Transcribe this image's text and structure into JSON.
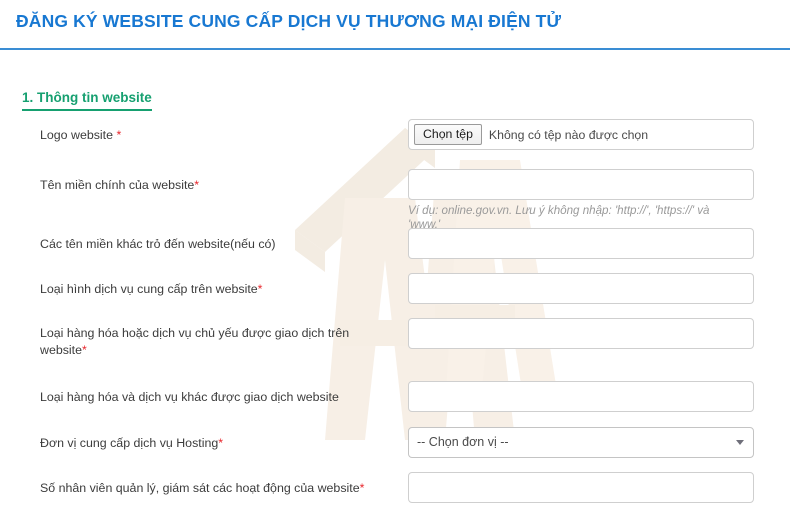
{
  "header": {
    "title": "ĐĂNG KÝ WEBSITE CUNG CẤP DỊCH VỤ THƯƠNG MẠI ĐIỆN TỬ",
    "rule_color": "#3a8dd4",
    "title_color": "#1878d2"
  },
  "section": {
    "heading": "1. Thông tin website",
    "heading_color": "#16a070"
  },
  "colors": {
    "required_marker": "#e8262c",
    "input_border": "#cfcfcf",
    "hint_text": "#9a9a9a",
    "label_text": "#3c3c3c"
  },
  "fields": {
    "logo": {
      "label": "Logo website ",
      "required_marker": "*",
      "control": "file",
      "button_label": "Chọn tệp",
      "status_text": "Không có tệp nào được chọn"
    },
    "main_domain": {
      "label": "Tên miền chính của website",
      "required_marker": "*",
      "control": "text",
      "value": "",
      "placeholder": "",
      "hint": "Ví dụ: online.gov.vn. Lưu ý không nhập: 'http://', 'https://' và 'www.'"
    },
    "other_domains": {
      "label": "Các tên miền khác trỏ đến website(nếu có)",
      "required_marker": "",
      "control": "text",
      "value": "",
      "placeholder": ""
    },
    "service_type": {
      "label": "Loại hình dịch vụ cung cấp trên website",
      "required_marker": "*",
      "control": "text",
      "value": "",
      "placeholder": ""
    },
    "main_goods": {
      "label": "Loại hàng hóa hoặc dịch vụ chủ yếu được giao dịch trên website",
      "required_marker": "*",
      "control": "text",
      "value": "",
      "placeholder": ""
    },
    "other_goods": {
      "label": "Loại hàng hóa và dịch vụ khác được giao dịch website",
      "required_marker": "",
      "control": "text",
      "value": "",
      "placeholder": ""
    },
    "hosting_provider": {
      "label": "Đơn vị cung cấp dịch vụ Hosting",
      "required_marker": "*",
      "control": "select",
      "selected_option": "-- Chọn đơn vị --"
    },
    "staff_count": {
      "label": "Số nhân viên quản lý, giám sát các hoạt động của website",
      "required_marker": "*",
      "control": "text",
      "value": "",
      "placeholder": ""
    }
  }
}
